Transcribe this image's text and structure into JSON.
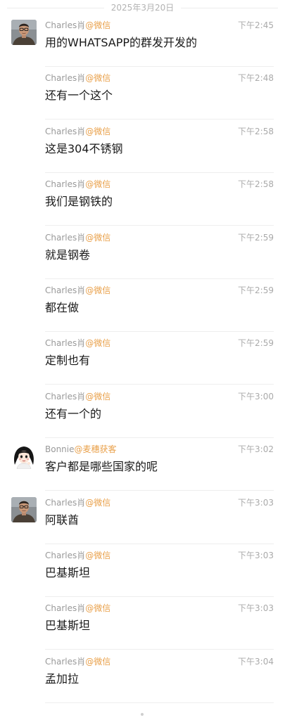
{
  "date_separator": "2025年3月20日",
  "colors": {
    "sender_name": "#999999",
    "sender_org": "#e9a04a",
    "message_text": "#1a1a1a",
    "timestamp": "#aaaaaa"
  },
  "messages": [
    {
      "sender": "Charles肖",
      "org": "@微信",
      "time": "下午2:45",
      "text": "用的WHATSAPP的群发开发的",
      "avatar": "charles-avatar"
    },
    {
      "sender": "Charles肖",
      "org": "@微信",
      "time": "下午2:48",
      "text": "还有一个这个",
      "avatar": ""
    },
    {
      "sender": "Charles肖",
      "org": "@微信",
      "time": "下午2:58",
      "text": "这是304不锈钢",
      "avatar": ""
    },
    {
      "sender": "Charles肖",
      "org": "@微信",
      "time": "下午2:58",
      "text": "我们是钢铁的",
      "avatar": ""
    },
    {
      "sender": "Charles肖",
      "org": "@微信",
      "time": "下午2:59",
      "text": "就是钢卷",
      "avatar": ""
    },
    {
      "sender": "Charles肖",
      "org": "@微信",
      "time": "下午2:59",
      "text": "都在做",
      "avatar": ""
    },
    {
      "sender": "Charles肖",
      "org": "@微信",
      "time": "下午2:59",
      "text": "定制也有",
      "avatar": ""
    },
    {
      "sender": "Charles肖",
      "org": "@微信",
      "time": "下午3:00",
      "text": "还有一个的",
      "avatar": ""
    },
    {
      "sender": "Bonnie",
      "org": "@麦穗获客",
      "time": "下午3:02",
      "text": "客户都是哪些国家的呢",
      "avatar": "bonnie-avatar"
    },
    {
      "sender": "Charles肖",
      "org": "@微信",
      "time": "下午3:03",
      "text": "阿联酋",
      "avatar": "charles-avatar"
    },
    {
      "sender": "Charles肖",
      "org": "@微信",
      "time": "下午3:03",
      "text": "巴基斯坦",
      "avatar": ""
    },
    {
      "sender": "Charles肖",
      "org": "@微信",
      "time": "下午3:03",
      "text": "巴基斯坦",
      "avatar": ""
    },
    {
      "sender": "Charles肖",
      "org": "@微信",
      "time": "下午3:04",
      "text": "孟加拉",
      "avatar": ""
    }
  ]
}
